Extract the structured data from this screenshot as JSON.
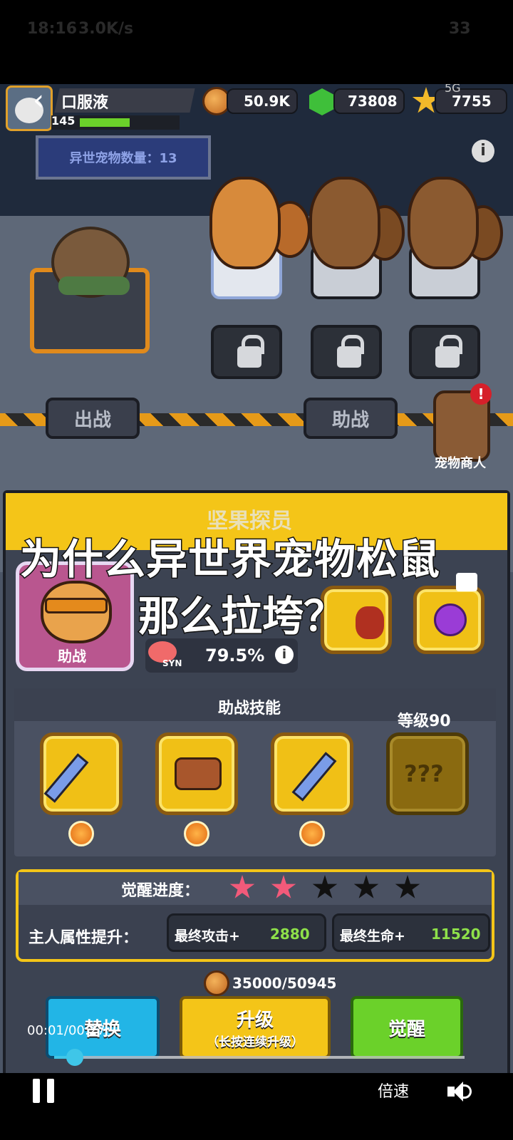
{
  "status_bar": {
    "time": "18:16",
    "speed": "3.0K/s",
    "battery": "33"
  },
  "player": {
    "name": "口服液",
    "level": "145"
  },
  "resources": {
    "coins": "50.9K",
    "gems": "73808",
    "stars": "7755",
    "network": "5G"
  },
  "pet_count_label": "异世宠物数量：13",
  "stage": {
    "battle_label": "出战",
    "assist_label": "助战",
    "merchant_label": "宠物商人"
  },
  "detail": {
    "pet_name": "坚果探员",
    "pet_role": "助战",
    "syn_label": "SYN",
    "syn_value": "79.5%",
    "skills_title": "助战技能",
    "locked_level": "等级90",
    "locked_skill": "???",
    "awaken_label": "觉醒进度：",
    "awaken_stars_filled": 2,
    "awaken_stars_total": 5,
    "bonus_label": "主人属性提升：",
    "attack_label": "最终攻击+",
    "attack_value": "2880",
    "life_label": "最终生命+",
    "life_value": "11520",
    "cost": "35000/50945"
  },
  "buttons": {
    "replace": "替换",
    "upgrade": "升级",
    "upgrade_hint": "（长按连续升级）",
    "awaken": "觉醒"
  },
  "caption": {
    "line1": "为什么异世界宠物松鼠",
    "line2": "那么拉垮？"
  },
  "video": {
    "time": "00:01/00:27",
    "progress": 0.05,
    "speed_label": "倍速"
  },
  "colors": {
    "gold": "#f4c518",
    "green": "#6bd12a",
    "blue": "#22b5e6"
  }
}
